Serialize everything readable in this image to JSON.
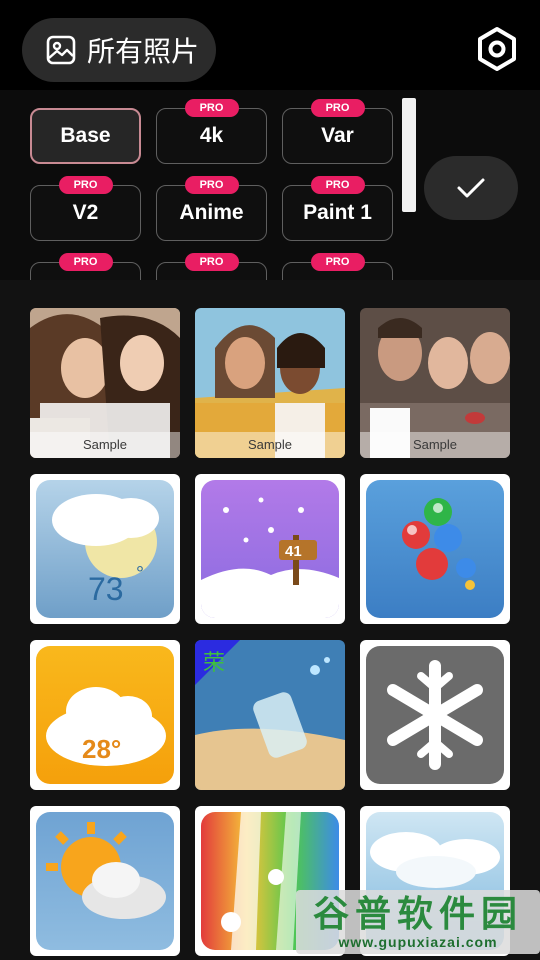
{
  "header": {
    "album_label": "所有照片",
    "album_icon": "gallery-icon",
    "settings_icon": "settings-hexagon-icon"
  },
  "models": {
    "badge": "PRO",
    "confirm_icon": "check-icon",
    "items": [
      {
        "label": "Base",
        "pro": false,
        "selected": true
      },
      {
        "label": "4k",
        "pro": true
      },
      {
        "label": "Var",
        "pro": true
      },
      {
        "label": "V2",
        "pro": true
      },
      {
        "label": "Anime",
        "pro": true
      },
      {
        "label": "Paint 1",
        "pro": true
      },
      {
        "label": "",
        "pro": true
      },
      {
        "label": "",
        "pro": true
      },
      {
        "label": "",
        "pro": true
      }
    ]
  },
  "gallery": {
    "sample_label": "Sample",
    "samples": [
      "group-photo-two-women",
      "couple-photo",
      "friends-photo"
    ],
    "icons": [
      "weather-73-icon",
      "snow-sign-41-icon",
      "bubbles-icon",
      "weather-28-icon",
      "bottle-beach-icon",
      "snowflake-icon",
      "sun-cloud-icon",
      "light-rays-icon",
      "sky-clouds-icon"
    ],
    "icon_texts": {
      "weather_73": "73",
      "weather_degree": "°",
      "snow_41": "41",
      "weather_28": "28°",
      "corner_badge": "荣"
    }
  },
  "watermark": {
    "title": "谷普软件园",
    "url": "www.gupuxiazai.com"
  }
}
